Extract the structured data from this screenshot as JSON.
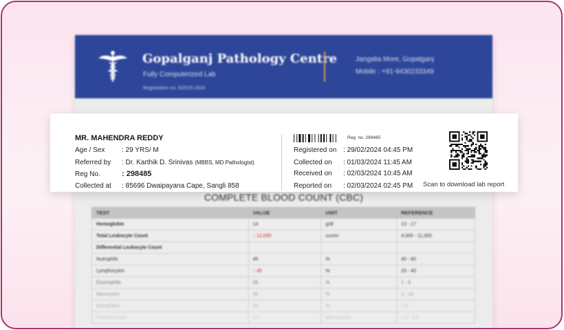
{
  "header": {
    "lab_name": "Gopalganj Pathology Centre",
    "tagline": "Fully Computerized Lab",
    "registration": "Registration no. 5/2015-2024",
    "address": "Jangalia More, Gopalganj",
    "mobile": "Mobile : +91-9430233349",
    "colors": {
      "header_bg": "#2d4699",
      "divider": "#d4a24a"
    }
  },
  "patient": {
    "name": "MR. MAHENDRA REDDY",
    "age_sex_label": "Age / Sex",
    "age_sex_value": ": 29 YRS/ M",
    "referred_label": "Referred by",
    "referred_value": ": Dr. Karthik D. Srinivas",
    "referred_qual": "(MBBS, MD Pathologist)",
    "reg_label": "Reg No.",
    "reg_value": ": 298485",
    "collected_at_label": "Collected at",
    "collected_at_value": ": 85696 Dwaipayana Cape, Sangli 858"
  },
  "report_meta": {
    "reg_small": "Reg. no. 298485",
    "registered_label": "Registered on",
    "registered_value": ": 29/02/2024  04:45 PM",
    "collected_label": "Collected on",
    "collected_value": ": 01/03/2024  11:45 AM",
    "received_label": "Received on",
    "received_value": ": 02/03/2024  10:45 AM",
    "reported_label": "Reported on",
    "reported_value": ": 02/03/2024  02:45 PM",
    "qr_caption": "Scan to download lab report"
  },
  "cbc": {
    "title": "COMPLETE BLOOD COUNT (CBC)",
    "headers": [
      "TEST",
      "VALUE",
      "UNIT",
      "REFERENCE"
    ],
    "rows": [
      {
        "test": "Hemoglobin",
        "value": "14",
        "unit": "g/dl",
        "reference": "13 - 17",
        "bold": true,
        "high": false
      },
      {
        "test": "Total Leukocyte Count",
        "value": "↑  12,000",
        "unit": "cumm",
        "reference": "4,000 - 11,000",
        "bold": true,
        "high": true
      },
      {
        "test": "Differential Leukocyte Count",
        "value": "",
        "unit": "",
        "reference": "",
        "bold": true,
        "high": false
      },
      {
        "test": "Nutrophils",
        "value": "45",
        "unit": "%",
        "reference": "40 - 80",
        "bold": false,
        "high": false
      },
      {
        "test": "Lymphocytes",
        "value": "↑  45",
        "unit": "%",
        "reference": "20 - 40",
        "bold": false,
        "high": true
      },
      {
        "test": "Eosinophils",
        "value": "05",
        "unit": "%",
        "reference": "1 - 6",
        "bold": false,
        "high": false
      },
      {
        "test": "Monocytes",
        "value": "05",
        "unit": "%",
        "reference": "2 - 10",
        "bold": false,
        "high": false
      },
      {
        "test": "Basophiles",
        "value": "00",
        "unit": "%",
        "reference": "< 2",
        "bold": false,
        "high": false
      },
      {
        "test": "Platelet Count",
        "value": "3.0",
        "unit": "lakhs/cumm",
        "reference": "1.5 - 4.5",
        "bold": false,
        "high": false
      }
    ],
    "colors": {
      "high": "#d42020"
    }
  }
}
